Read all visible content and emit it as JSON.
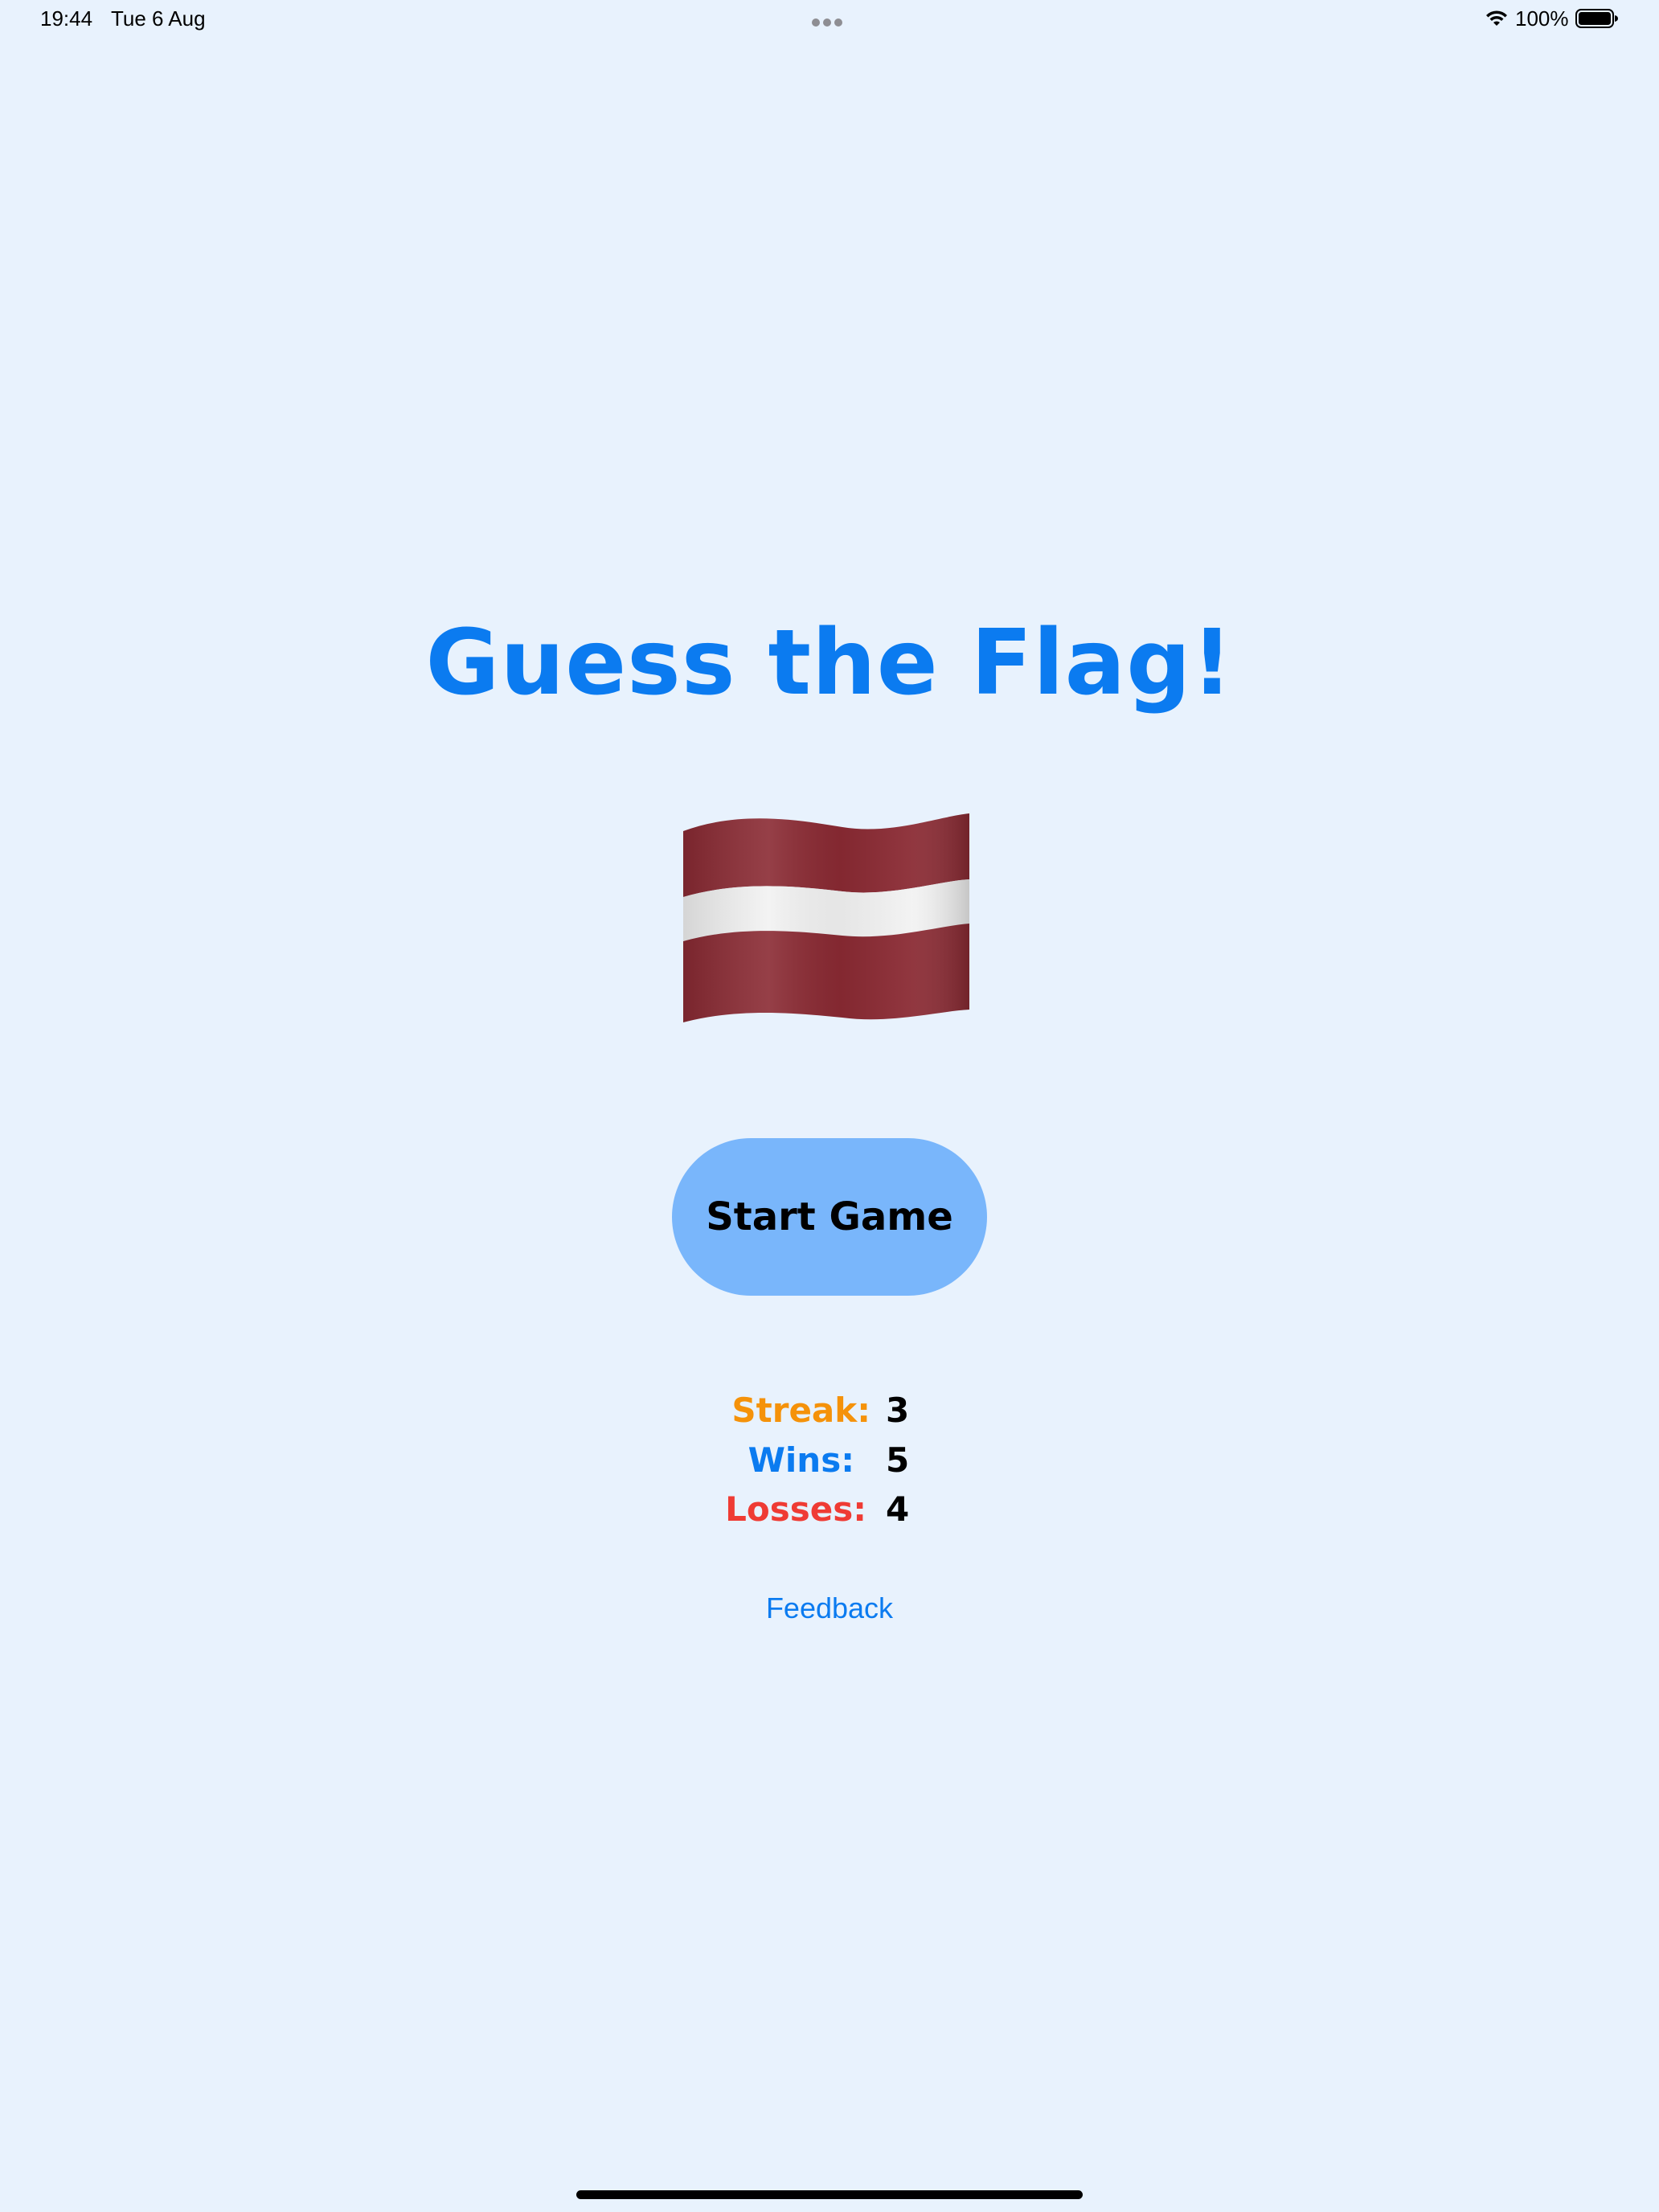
{
  "status_bar": {
    "time": "19:44",
    "date": "Tue 6 Aug",
    "battery_percent": "100%",
    "wifi_icon": "wifi-icon",
    "battery_icon": "battery-full-icon"
  },
  "title": "Guess the Flag!",
  "flag": {
    "icon": "latvia-flag-icon",
    "colors": {
      "carmine": "#8a2a33",
      "white": "#f2f2f2"
    }
  },
  "start_button": {
    "label": "Start Game"
  },
  "stats": {
    "streak_label": "Streak:",
    "streak_value": "3",
    "wins_label": "Wins:",
    "wins_value": "5",
    "losses_label": "Losses:",
    "losses_value": "4"
  },
  "feedback": {
    "label": "Feedback"
  },
  "colors": {
    "background": "#e8f2fd",
    "accent_blue": "#0b7bf0",
    "button_blue": "#79b6fb",
    "streak_orange": "#f5920a",
    "losses_red": "#ef3b34"
  }
}
